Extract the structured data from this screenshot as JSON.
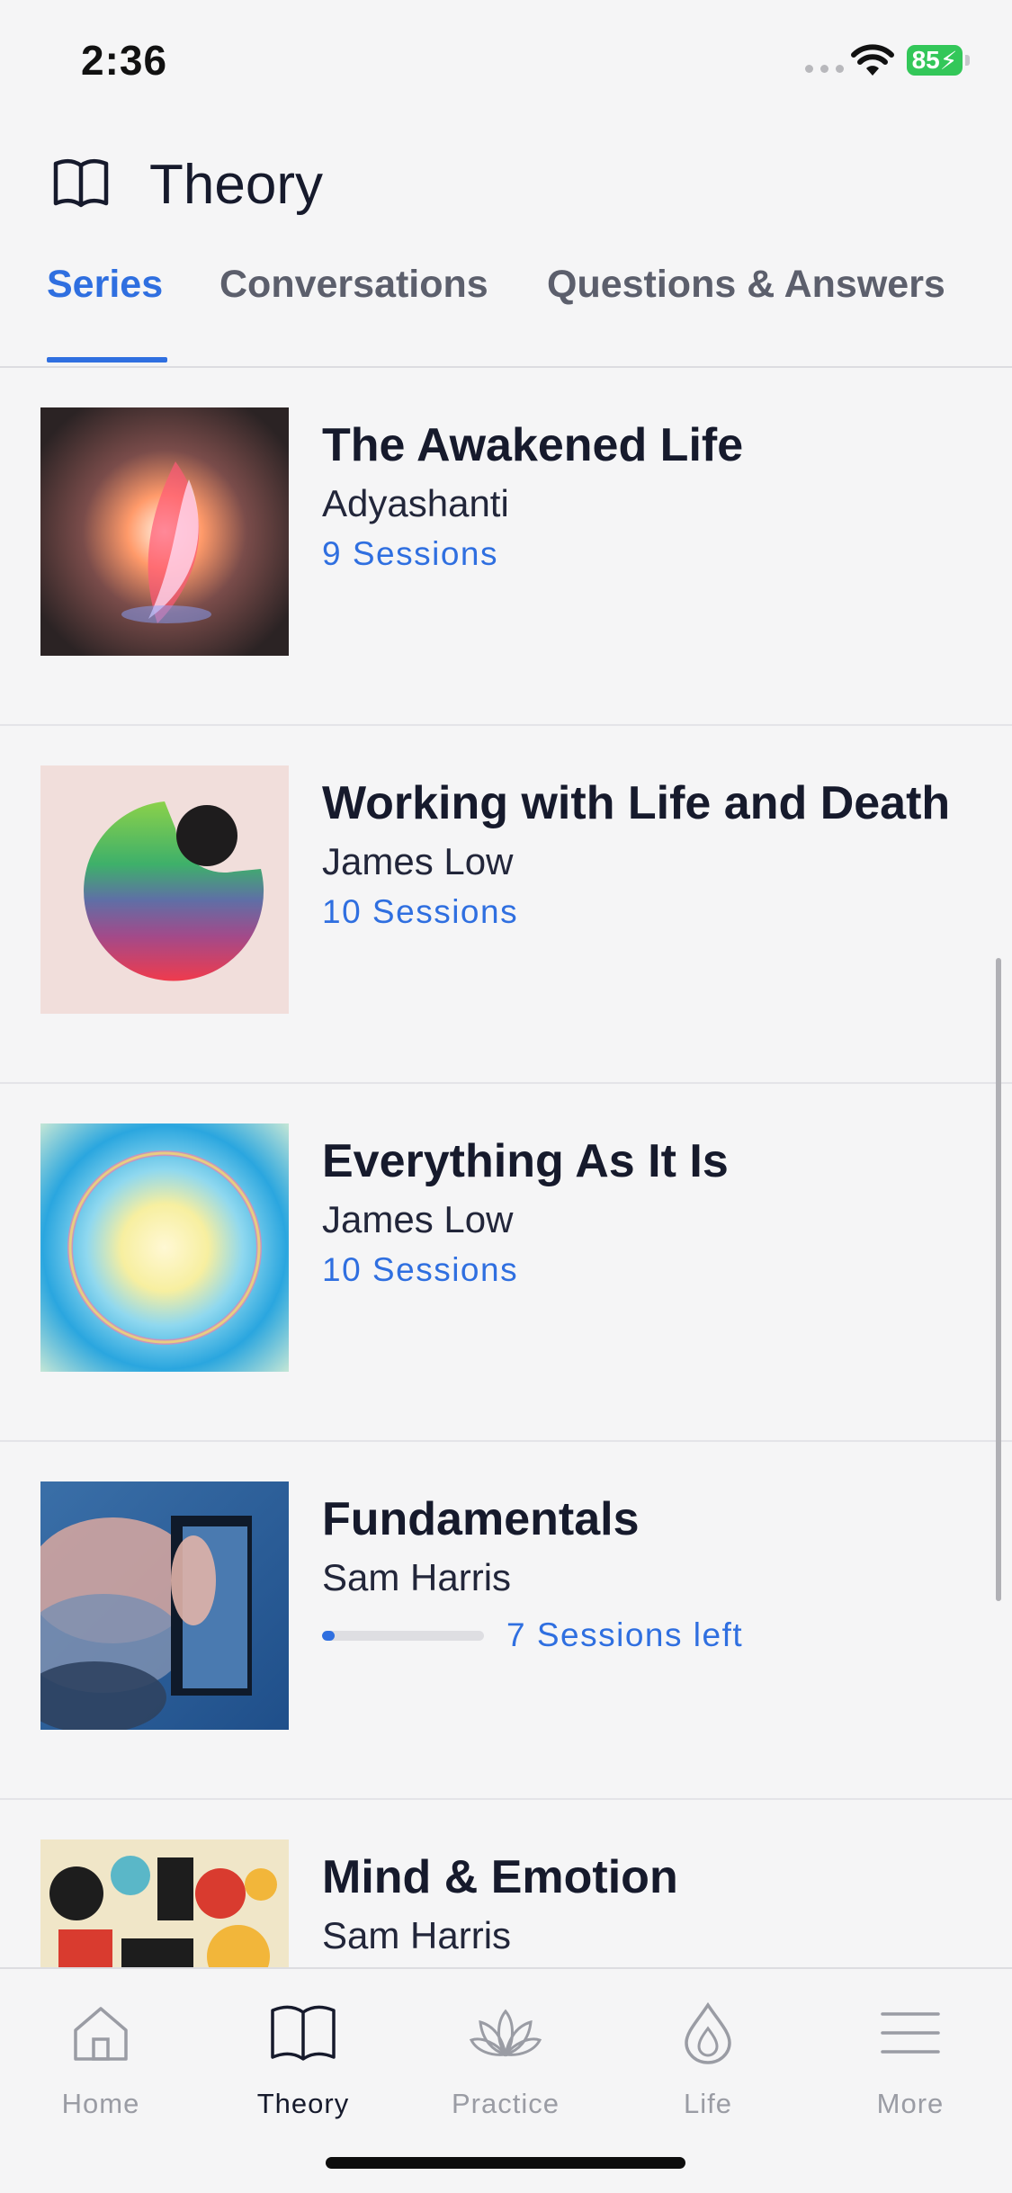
{
  "status_bar": {
    "time": "2:36",
    "battery": "85"
  },
  "header": {
    "title": "Theory",
    "icon": "book-open-icon"
  },
  "tabs": [
    {
      "label": "Series",
      "active": true
    },
    {
      "label": "Conversations",
      "active": false
    },
    {
      "label": "Questions & Answers",
      "active": false
    }
  ],
  "series": [
    {
      "title": "The Awakened Life",
      "author": "Adyashanti",
      "sessions": "9 Sessions"
    },
    {
      "title": "Working with Life and Death",
      "author": "James Low",
      "sessions": "10 Sessions"
    },
    {
      "title": "Everything As It Is",
      "author": "James Low",
      "sessions": "10 Sessions"
    },
    {
      "title": "Fundamentals",
      "author": "Sam Harris",
      "sessions_left": "7 Sessions left",
      "progress": 0.08
    },
    {
      "title": "Mind & Emotion",
      "author": "Sam Harris"
    }
  ],
  "tabbar": [
    {
      "label": "Home",
      "icon": "home-icon",
      "active": false
    },
    {
      "label": "Theory",
      "icon": "book-open-icon",
      "active": true
    },
    {
      "label": "Practice",
      "icon": "lotus-icon",
      "active": false
    },
    {
      "label": "Life",
      "icon": "drop-icon",
      "active": false
    },
    {
      "label": "More",
      "icon": "menu-icon",
      "active": false
    }
  ],
  "colors": {
    "accent": "#2f6fe0",
    "text": "#161a2c",
    "background": "#f5f5f6",
    "battery": "#33c759"
  }
}
